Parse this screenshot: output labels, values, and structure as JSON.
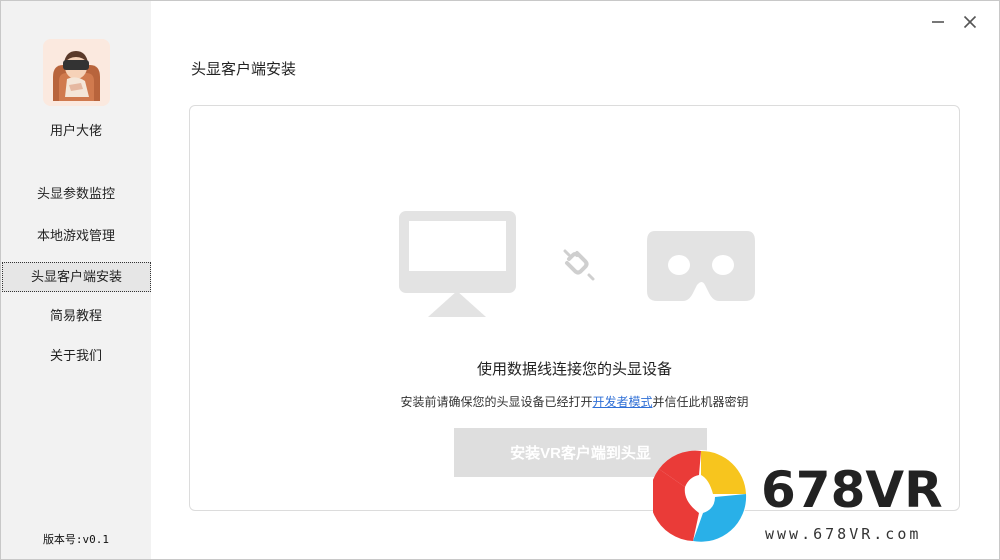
{
  "sidebar": {
    "username": "用户大佬",
    "items": [
      {
        "label": "头显参数监控"
      },
      {
        "label": "本地游戏管理"
      },
      {
        "label": "头显客户端安装"
      },
      {
        "label": "简易教程"
      },
      {
        "label": "关于我们"
      }
    ],
    "version": "版本号:v0.1"
  },
  "main": {
    "title": "头显客户端安装",
    "connect_title": "使用数据线连接您的头显设备",
    "desc_before": "安装前请确保您的头显设备已经打开",
    "desc_link": "开发者模式",
    "desc_after": "并信任此机器密钥",
    "install_button": "安装VR客户端到头显"
  },
  "watermark": {
    "brand": "678VR",
    "url": "www.678VR.com"
  },
  "colors": {
    "sidebar_bg": "#f2f2f2",
    "illustration": "#e3e3e3",
    "link": "#2f6fd6",
    "button_disabled": "#dedede"
  },
  "icons": [
    "minimize-icon",
    "close-icon",
    "monitor-icon",
    "broken-link-icon",
    "vr-headset-icon"
  ]
}
